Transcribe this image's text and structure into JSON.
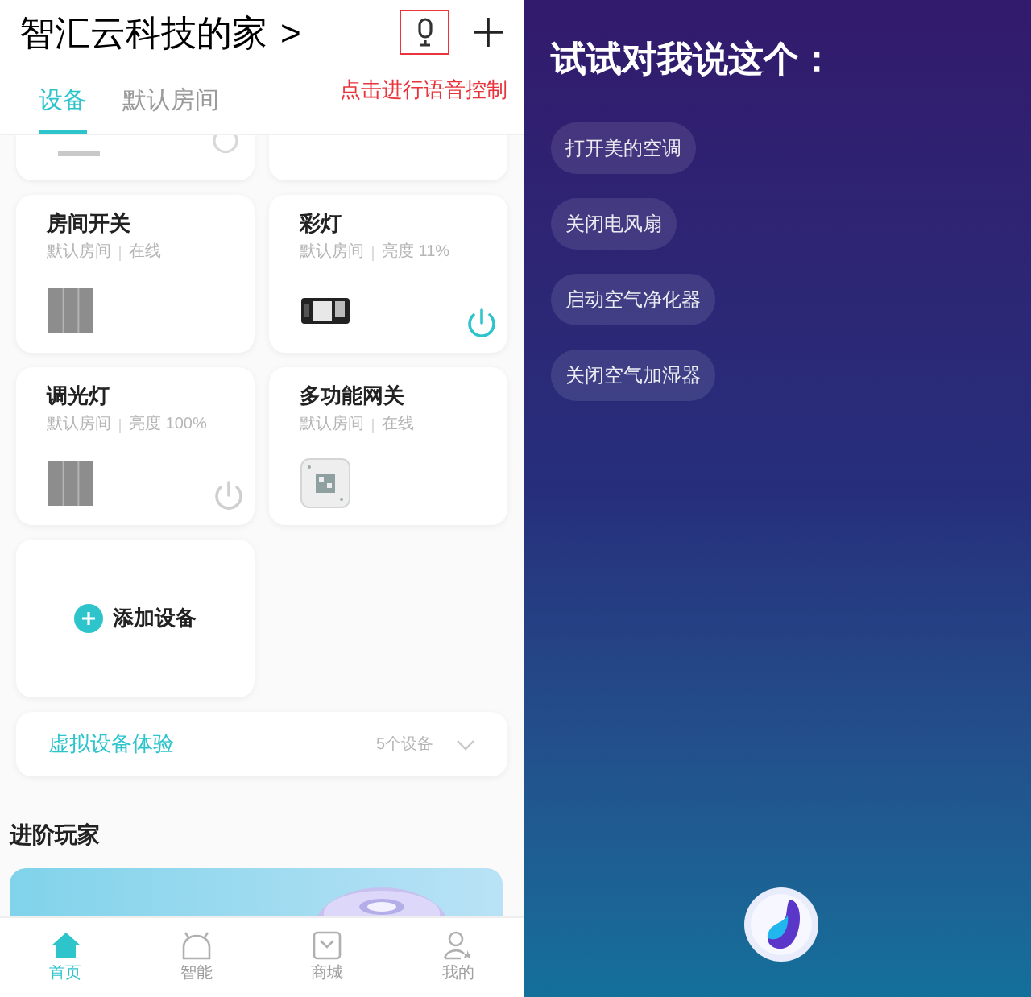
{
  "header": {
    "title": "智汇云科技的家",
    "chevron": ">",
    "voice_hint": "点击进行语音控制"
  },
  "tabs": [
    {
      "label": "设备",
      "selected": true
    },
    {
      "label": "默认房间",
      "selected": false
    }
  ],
  "devices": [
    {
      "name": "房间开关",
      "room": "默认房间",
      "status": "在线",
      "kind": "switch"
    },
    {
      "name": "彩灯",
      "room": "默认房间",
      "status": "亮度 11%",
      "kind": "light",
      "power": true
    },
    {
      "name": "调光灯",
      "room": "默认房间",
      "status": "亮度 100%",
      "kind": "switch",
      "power": false
    },
    {
      "name": "多功能网关",
      "room": "默认房间",
      "status": "在线",
      "kind": "gateway"
    }
  ],
  "add_device": "添加设备",
  "virtual": {
    "label": "虚拟设备体验",
    "count": "5个设备"
  },
  "section_title": "进阶玩家",
  "nav": [
    {
      "label": "首页",
      "selected": true,
      "kind": "home"
    },
    {
      "label": "智能",
      "selected": false,
      "kind": "robot"
    },
    {
      "label": "商城",
      "selected": false,
      "kind": "bag"
    },
    {
      "label": "我的",
      "selected": false,
      "kind": "user"
    }
  ],
  "voice_panel": {
    "title": "试试对我说这个：",
    "suggestions": [
      "打开美的空调",
      "关闭电风扇",
      "启动空气净化器",
      "关闭空气加湿器"
    ]
  }
}
